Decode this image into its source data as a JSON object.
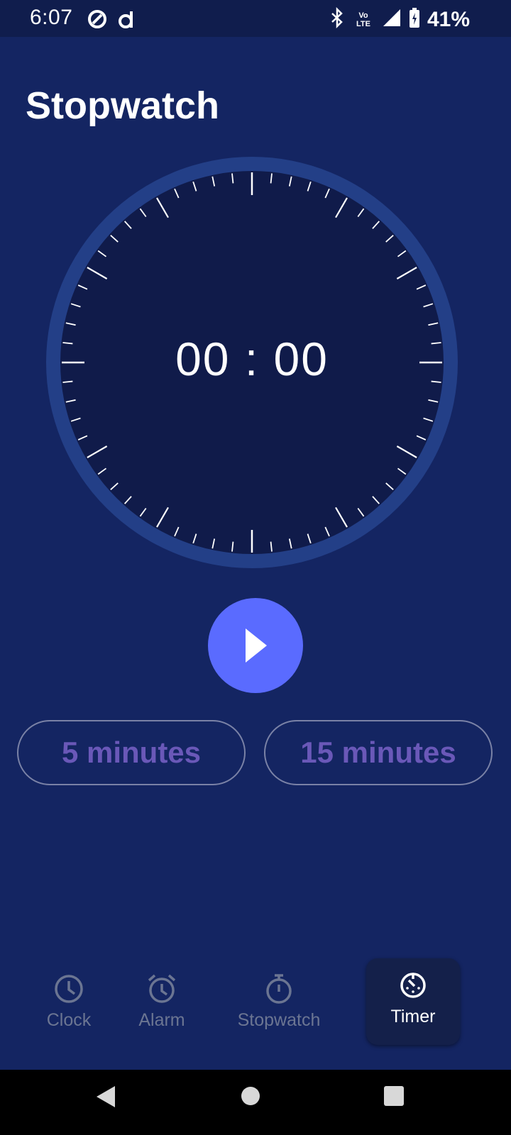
{
  "status_bar": {
    "time": "6:07",
    "network_label": "Vo LTE",
    "battery": "41%",
    "icons": [
      "nav-app-icon",
      "d-app-icon",
      "bluetooth-icon",
      "volte-icon",
      "signal-icon",
      "battery-charging-icon"
    ]
  },
  "page": {
    "title": "Stopwatch"
  },
  "timer": {
    "display": "00 : 00"
  },
  "presets": [
    {
      "label": "5 minutes"
    },
    {
      "label": "15 minutes"
    }
  ],
  "bottom_nav": {
    "items": [
      {
        "label": "Clock",
        "icon": "clock-icon"
      },
      {
        "label": "Alarm",
        "icon": "alarm-icon"
      },
      {
        "label": "Stopwatch",
        "icon": "stopwatch-icon"
      },
      {
        "label": "Timer",
        "icon": "timer-icon",
        "selected": true
      }
    ]
  },
  "colors": {
    "background": "#142562",
    "status_bar": "#101d4d",
    "dial_ring": "#233f87",
    "dial_face": "#101b4a",
    "accent": "#5a6bff",
    "preset_text": "#6a58b8",
    "nav_inactive": "#6b7592"
  }
}
